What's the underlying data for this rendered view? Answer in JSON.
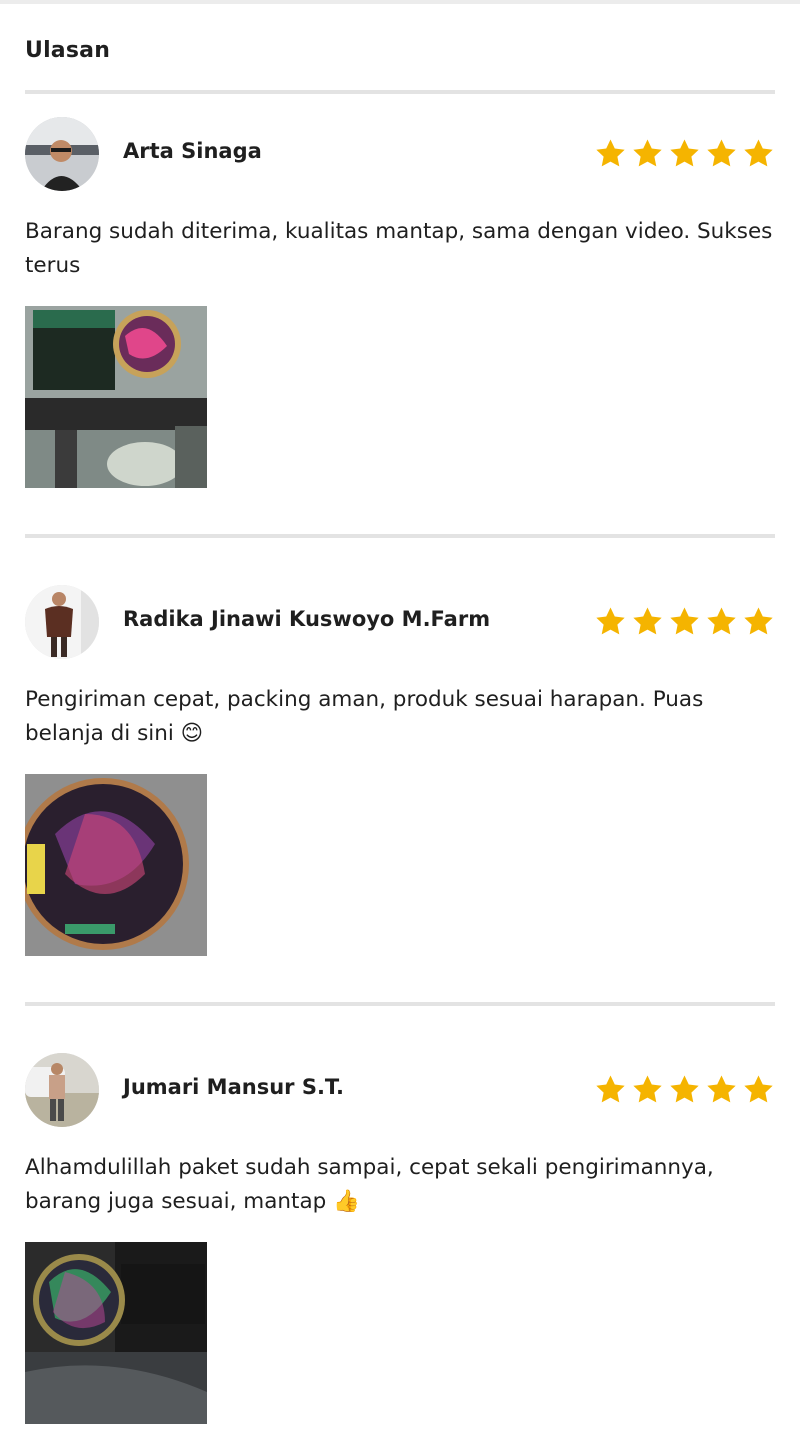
{
  "section": {
    "title": "Ulasan"
  },
  "colors": {
    "star": "#f5b400",
    "divider": "#e3e3e3"
  },
  "reviews": [
    {
      "name": "Arta Sinaga",
      "rating": 5,
      "text": "Barang sudah diterima, kualitas mantap, sama dengan video. Sukses terus",
      "photo_icon": "product-photo"
    },
    {
      "name": "Radika Jinawi Kuswoyo M.Farm",
      "rating": 5,
      "text": "Pengiriman cepat, packing aman, produk sesuai harapan. Puas belanja di sini 😊",
      "photo_icon": "product-photo"
    },
    {
      "name": "Jumari Mansur S.T.",
      "rating": 5,
      "text": "Alhamdulillah paket sudah sampai, cepat sekali pengirimannya, barang juga sesuai, mantap 👍",
      "photo_icon": "product-photo"
    }
  ]
}
